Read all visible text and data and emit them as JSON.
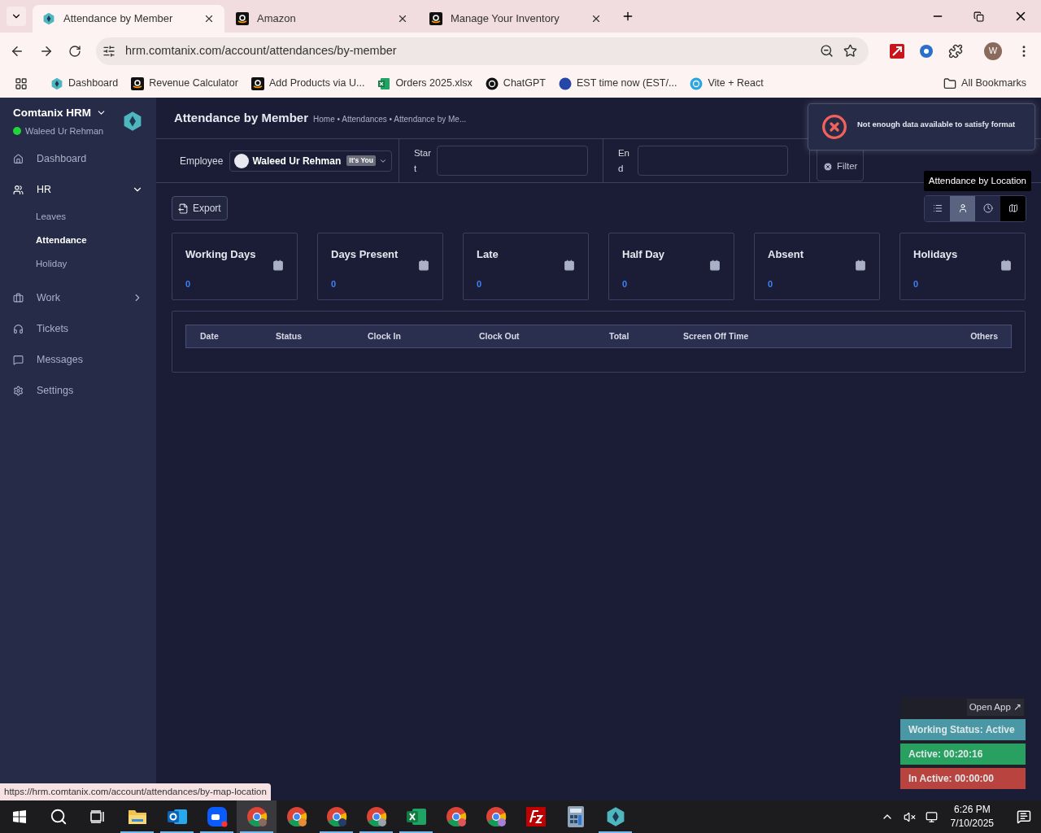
{
  "browser": {
    "tabs": [
      {
        "title": "Attendance by Member",
        "selected": true
      },
      {
        "title": "Amazon",
        "selected": false
      },
      {
        "title": "Manage Your Inventory",
        "selected": false
      }
    ],
    "url": "hrm.comtanix.com/account/attendances/by-member",
    "bookmarks": [
      "Dashboard",
      "Revenue Calculator",
      "Add Products via U...",
      "Orders 2025.xlsx",
      "ChatGPT",
      "EST time now (EST/...",
      "Vite + React"
    ],
    "all_bookmarks": "All Bookmarks",
    "profile": "W"
  },
  "sidebar": {
    "app_name": "Comtanix HRM",
    "user": "Waleed Ur Rehman",
    "online": true,
    "items": [
      {
        "label": "Dashboard",
        "expanded": false
      },
      {
        "label": "HR",
        "expanded": true,
        "children": [
          {
            "label": "Leaves",
            "selected": false
          },
          {
            "label": "Attendance",
            "selected": true
          },
          {
            "label": "Holiday",
            "selected": false
          }
        ]
      },
      {
        "label": "Work",
        "expanded": false,
        "expandable": true
      },
      {
        "label": "Tickets",
        "expanded": false
      },
      {
        "label": "Messages",
        "expanded": false
      },
      {
        "label": "Settings",
        "expanded": false
      }
    ]
  },
  "header": {
    "title": "Attendance by Member",
    "breadcrumb": "Home • Attendances • Attendance by Me..."
  },
  "filters": {
    "employee_label": "Employee",
    "employee": "Waleed Ur Rehman",
    "badge": "It's You",
    "start_label": "Start",
    "end_label": "End",
    "filter_button": "Filter"
  },
  "export_button": "Export",
  "views": [
    {
      "selected": false,
      "hovered": false
    },
    {
      "selected": true,
      "hovered": false
    },
    {
      "selected": false,
      "hovered": false
    },
    {
      "selected": false,
      "hovered": true
    }
  ],
  "tooltip": "Attendance by Location",
  "toast": "Not enough data available to satisfy format",
  "stats": [
    {
      "label": "Working Days",
      "value": "0"
    },
    {
      "label": "Days Present",
      "value": "0"
    },
    {
      "label": "Late",
      "value": "0"
    },
    {
      "label": "Half Day",
      "value": "0"
    },
    {
      "label": "Absent",
      "value": "0"
    },
    {
      "label": "Holidays",
      "value": "0"
    }
  ],
  "table": {
    "columns": [
      "Date",
      "Status",
      "Clock In",
      "Clock Out",
      "Total",
      "Screen Off Time",
      "Others"
    ]
  },
  "widget": {
    "open_app": "Open App ↗",
    "statuses": [
      {
        "text": "Working Status: Active",
        "color": "#4a97a5"
      },
      {
        "text": "Active: 00:20:16",
        "color": "#27a060"
      },
      {
        "text": "In Active: 00:00:00",
        "color": "#b8433f"
      }
    ]
  },
  "status_url": "https://hrm.comtanix.com/account/attendances/by-map-location",
  "taskbar": {
    "apps": [
      {
        "running": true,
        "selected": false
      },
      {
        "running": true,
        "selected": false
      },
      {
        "running": true,
        "selected": false
      },
      {
        "running": true,
        "selected": true
      },
      {
        "running": false,
        "selected": false
      },
      {
        "running": true,
        "selected": false
      },
      {
        "running": true,
        "selected": false
      },
      {
        "running": true,
        "selected": false
      },
      {
        "running": false,
        "selected": false
      },
      {
        "running": false,
        "selected": false
      },
      {
        "running": false,
        "selected": false
      },
      {
        "running": false,
        "selected": false
      },
      {
        "running": true,
        "selected": false
      }
    ],
    "time": "6:26 PM",
    "date": "7/10/2025"
  }
}
